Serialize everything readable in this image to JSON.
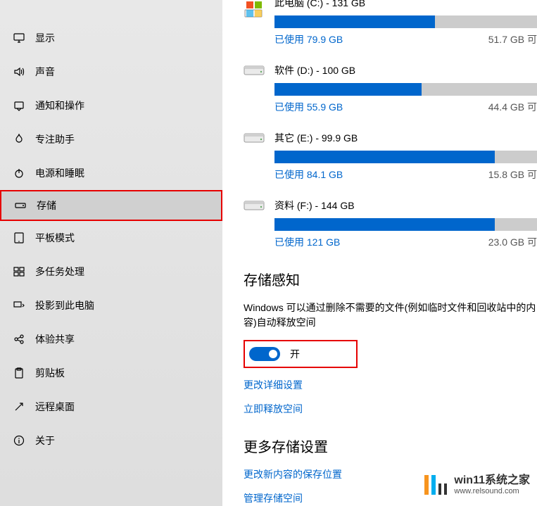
{
  "sidebar": {
    "items": [
      {
        "label": "显示",
        "icon": "display"
      },
      {
        "label": "声音",
        "icon": "sound"
      },
      {
        "label": "通知和操作",
        "icon": "notifications"
      },
      {
        "label": "专注助手",
        "icon": "focus"
      },
      {
        "label": "电源和睡眠",
        "icon": "power"
      },
      {
        "label": "存储",
        "icon": "storage",
        "selected": true
      },
      {
        "label": "平板模式",
        "icon": "tablet"
      },
      {
        "label": "多任务处理",
        "icon": "multitask"
      },
      {
        "label": "投影到此电脑",
        "icon": "project"
      },
      {
        "label": "体验共享",
        "icon": "shared"
      },
      {
        "label": "剪贴板",
        "icon": "clipboard"
      },
      {
        "label": "远程桌面",
        "icon": "remote"
      },
      {
        "label": "关于",
        "icon": "about"
      }
    ]
  },
  "drives": [
    {
      "title": "此电脑 (C:) - 131 GB",
      "used": "已使用 79.9 GB",
      "free": "51.7 GB 可",
      "pct": 61,
      "os": true
    },
    {
      "title": "软件 (D:) - 100 GB",
      "used": "已使用 55.9 GB",
      "free": "44.4 GB 可",
      "pct": 56,
      "os": false
    },
    {
      "title": "其它 (E:) - 99.9 GB",
      "used": "已使用 84.1 GB",
      "free": "15.8 GB 可",
      "pct": 84,
      "os": false
    },
    {
      "title": "资料 (F:) - 144 GB",
      "used": "已使用 121 GB",
      "free": "23.0 GB 可",
      "pct": 84,
      "os": false
    }
  ],
  "storage_sense": {
    "title": "存储感知",
    "desc": "Windows 可以通过删除不需要的文件(例如临时文件和回收站中的内容)自动释放空间",
    "toggle_state": "开",
    "link_details": "更改详细设置",
    "link_free_now": "立即释放空间"
  },
  "more_settings": {
    "title": "更多存储设置",
    "link_save_loc": "更改新内容的保存位置",
    "link_manage": "管理存储空间"
  },
  "watermark": {
    "big": "win11系统之家",
    "url": "www.relsound.com"
  }
}
